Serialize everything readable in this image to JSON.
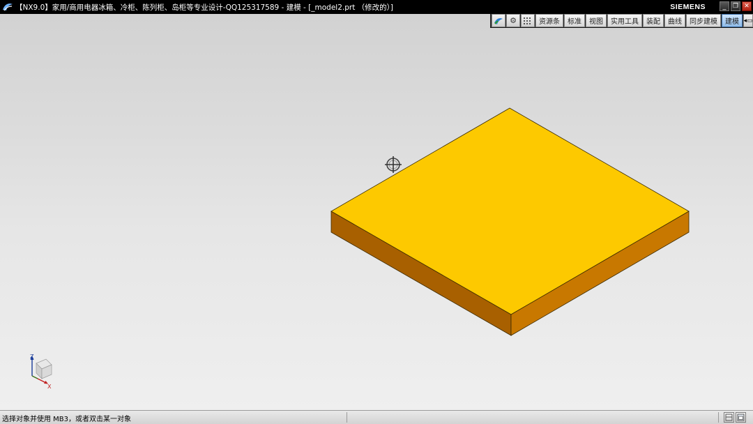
{
  "window": {
    "title": "【NX9.0】家用/商用电器冰箱、冷柜、陈列柜、岛柜等专业设计-QQ125317589 - 建模 - [_model2.prt （修改的）]",
    "brand": "SIEMENS",
    "minimize_glyph": "_",
    "restore_glyph": "❐",
    "close_glyph": "✕"
  },
  "ribbon": {
    "tabs": [
      "资源条",
      "标准",
      "视图",
      "实用工具",
      "装配",
      "曲线",
      "同步建模",
      "建模"
    ],
    "active_tab": "建模"
  },
  "triad": {
    "z": "Z",
    "x": "X"
  },
  "status": {
    "prompt": "选择对象并使用 MB3，或者双击某一对象"
  },
  "colors": {
    "solid_top": "#FDC900",
    "solid_left": "#A86000",
    "solid_right": "#C87800",
    "active_tab": "#8FBBE8"
  }
}
